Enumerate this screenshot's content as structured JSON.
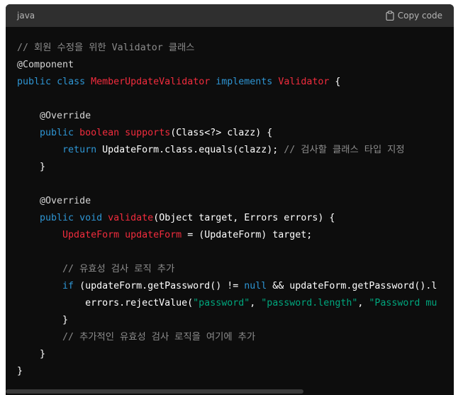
{
  "header": {
    "language": "java",
    "copy_label": "Copy code"
  },
  "code_lines": [
    [
      {
        "t": "comment",
        "v": "// 회원 수정을 위한 Validator 클래스"
      }
    ],
    [
      {
        "t": "annot",
        "v": "@Component"
      }
    ],
    [
      {
        "t": "kw",
        "v": "public"
      },
      {
        "t": "plain",
        "v": " "
      },
      {
        "t": "kw",
        "v": "class"
      },
      {
        "t": "plain",
        "v": " "
      },
      {
        "t": "type",
        "v": "MemberUpdateValidator"
      },
      {
        "t": "plain",
        "v": " "
      },
      {
        "t": "kw",
        "v": "implements"
      },
      {
        "t": "plain",
        "v": " "
      },
      {
        "t": "type",
        "v": "Validator"
      },
      {
        "t": "plain",
        "v": " {"
      }
    ],
    [],
    [
      {
        "t": "plain",
        "v": "    "
      },
      {
        "t": "annot",
        "v": "@Override"
      }
    ],
    [
      {
        "t": "plain",
        "v": "    "
      },
      {
        "t": "kw",
        "v": "public"
      },
      {
        "t": "plain",
        "v": " "
      },
      {
        "t": "type",
        "v": "boolean"
      },
      {
        "t": "plain",
        "v": " "
      },
      {
        "t": "fn",
        "v": "supports"
      },
      {
        "t": "plain",
        "v": "(Class<?> clazz) {"
      }
    ],
    [
      {
        "t": "plain",
        "v": "        "
      },
      {
        "t": "kw",
        "v": "return"
      },
      {
        "t": "plain",
        "v": " UpdateForm.class.equals(clazz); "
      },
      {
        "t": "comment",
        "v": "// 검사할 클래스 타입 지정"
      }
    ],
    [
      {
        "t": "plain",
        "v": "    }"
      }
    ],
    [],
    [
      {
        "t": "plain",
        "v": "    "
      },
      {
        "t": "annot",
        "v": "@Override"
      }
    ],
    [
      {
        "t": "plain",
        "v": "    "
      },
      {
        "t": "kw",
        "v": "public"
      },
      {
        "t": "plain",
        "v": " "
      },
      {
        "t": "kw",
        "v": "void"
      },
      {
        "t": "plain",
        "v": " "
      },
      {
        "t": "fn",
        "v": "validate"
      },
      {
        "t": "plain",
        "v": "(Object target, Errors errors) {"
      }
    ],
    [
      {
        "t": "plain",
        "v": "        "
      },
      {
        "t": "type",
        "v": "UpdateForm"
      },
      {
        "t": "plain",
        "v": " "
      },
      {
        "t": "type",
        "v": "updateForm"
      },
      {
        "t": "plain",
        "v": " = (UpdateForm) target;"
      }
    ],
    [],
    [
      {
        "t": "plain",
        "v": "        "
      },
      {
        "t": "comment",
        "v": "// 유효성 검사 로직 추가"
      }
    ],
    [
      {
        "t": "plain",
        "v": "        "
      },
      {
        "t": "kw",
        "v": "if"
      },
      {
        "t": "plain",
        "v": " (updateForm.getPassword() != "
      },
      {
        "t": "kw",
        "v": "null"
      },
      {
        "t": "plain",
        "v": " && updateForm.getPassword().l"
      }
    ],
    [
      {
        "t": "plain",
        "v": "            errors.rejectValue("
      },
      {
        "t": "str",
        "v": "\"password\""
      },
      {
        "t": "plain",
        "v": ", "
      },
      {
        "t": "str",
        "v": "\"password.length\""
      },
      {
        "t": "plain",
        "v": ", "
      },
      {
        "t": "str",
        "v": "\"Password mu"
      }
    ],
    [
      {
        "t": "plain",
        "v": "        }"
      }
    ],
    [
      {
        "t": "plain",
        "v": "        "
      },
      {
        "t": "comment",
        "v": "// 추가적인 유효성 검사 로직을 여기에 추가"
      }
    ],
    [
      {
        "t": "plain",
        "v": "    }"
      }
    ],
    [
      {
        "t": "plain",
        "v": "}"
      }
    ]
  ]
}
